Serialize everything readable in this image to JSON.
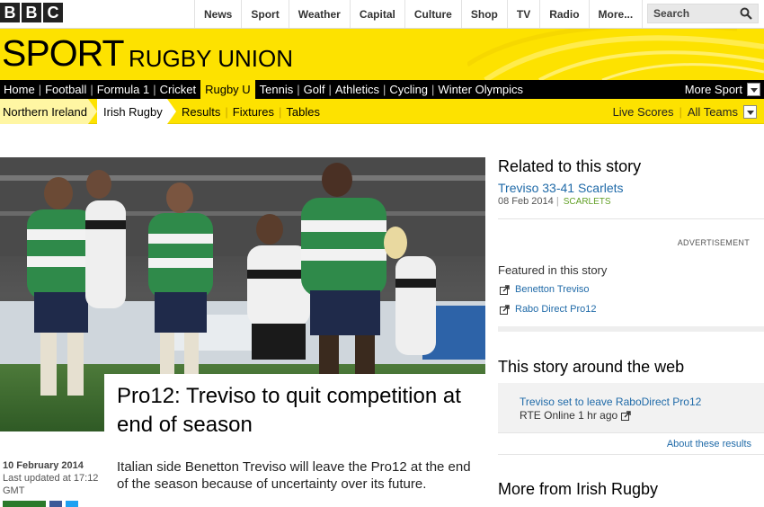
{
  "logo": {
    "letters": [
      "B",
      "B",
      "C"
    ]
  },
  "top_nav": [
    "News",
    "Sport",
    "Weather",
    "Capital",
    "Culture",
    "Shop",
    "TV",
    "Radio",
    "More..."
  ],
  "search": {
    "placeholder": "Search"
  },
  "banner": {
    "title": "SPORT",
    "section": "RUGBY UNION"
  },
  "sport_nav": {
    "items": [
      "Home",
      "Football",
      "Formula 1",
      "Cricket",
      "Rugby U",
      "Tennis",
      "Golf",
      "Athletics",
      "Cycling",
      "Winter Olympics"
    ],
    "active": "Rugby U",
    "more": "More Sport"
  },
  "sub_nav": {
    "breadcrumb": [
      "Northern Ireland",
      "Irish Rugby"
    ],
    "links": [
      "Results",
      "Fixtures",
      "Tables"
    ],
    "live_scores": "Live Scores",
    "all_teams": "All Teams"
  },
  "article": {
    "headline": "Pro12: Treviso to quit competition at end of season",
    "date": "10 February 2014",
    "updated": "Last updated at 17:12 GMT",
    "intro": "Italian side Benetton Treviso will leave the Pro12 at the end of the season because of uncertainty over its future."
  },
  "sidebar": {
    "related_title": "Related to this story",
    "related_link": "Treviso 33-41 Scarlets",
    "related_date": "08 Feb 2014",
    "related_tag": "SCARLETS",
    "advertisement": "ADVERTISEMENT",
    "featured_title": "Featured in this story",
    "featured": [
      "Benetton Treviso",
      "Rabo Direct Pro12"
    ],
    "web_title": "This story around the web",
    "web_link": "Treviso set to leave RaboDirect Pro12",
    "web_meta": "RTE Online 1 hr ago",
    "about": "About these results",
    "more_title": "More from Irish Rugby"
  },
  "colors": {
    "bbc_yellow": "#fde200",
    "link_blue": "#1f6aa8",
    "tag_green": "#62a026"
  }
}
